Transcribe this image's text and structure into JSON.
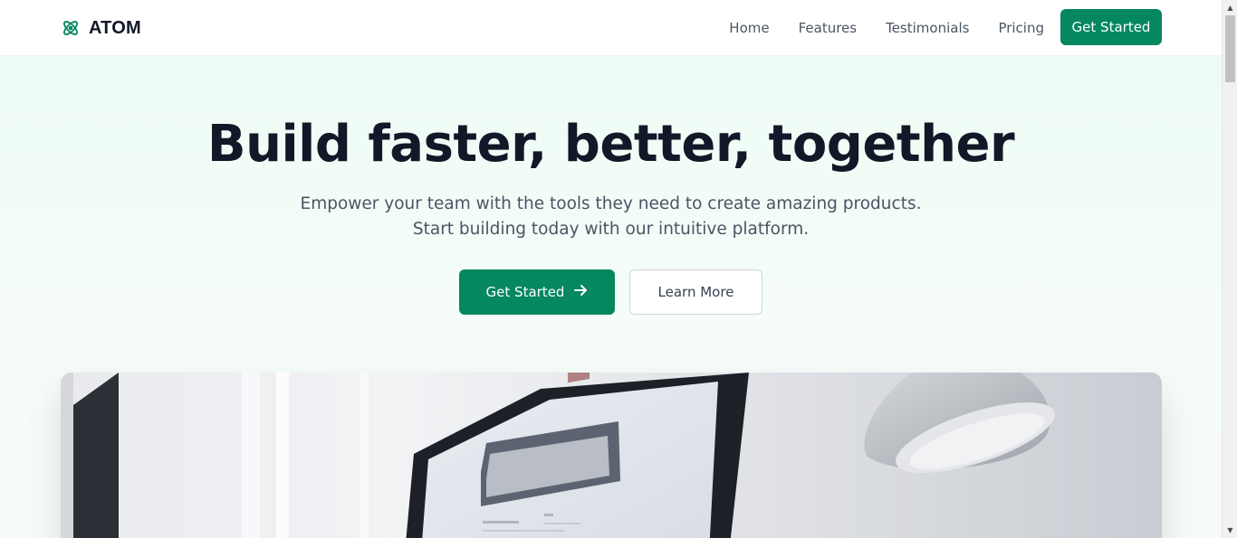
{
  "nav": {
    "brand": "ATOM",
    "links": [
      "Home",
      "Features",
      "Testimonials",
      "Pricing"
    ],
    "cta": "Get Started"
  },
  "hero": {
    "title": "Build faster, better, together",
    "subtitle_line1": "Empower your team with the tools they need to create amazing products.",
    "subtitle_line2": "Start building today with our intuitive platform.",
    "primary_cta": "Get Started",
    "secondary_cta": "Learn More"
  },
  "theme": {
    "accent": "#058760",
    "heading": "#111827",
    "muted": "#4b5563"
  },
  "icons": {
    "brand": "atom-icon",
    "primary_cta": "arrow-right-icon"
  }
}
